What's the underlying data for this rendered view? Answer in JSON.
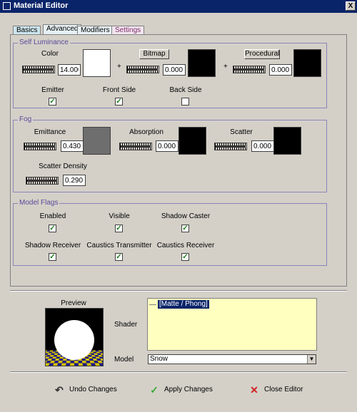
{
  "window": {
    "title": "Material Editor",
    "close_glyph": "X"
  },
  "tabs": [
    {
      "label": "Basics"
    },
    {
      "label": "Advanced"
    },
    {
      "label": "Modifiers"
    },
    {
      "label": "Settings"
    }
  ],
  "self_luminance": {
    "group_label": "Self Luminance",
    "color_label": "Color",
    "color_value": "14.000",
    "bitmap_button": "Bitmap",
    "bitmap_value": "0.000",
    "procedural_button": "Procedural",
    "procedural_value": "0.000",
    "plus_sign": "+",
    "emitter_label": "Emitter",
    "emitter_checked": true,
    "front_side_label": "Front Side",
    "front_side_checked": true,
    "back_side_label": "Back Side",
    "back_side_checked": false,
    "color_swatch": "#ffffff",
    "bitmap_swatch": "#000000",
    "procedural_swatch": "#000000"
  },
  "fog": {
    "group_label": "Fog",
    "emittance_label": "Emittance",
    "emittance_value": "0.430",
    "emittance_swatch": "#6e6e6e",
    "absorption_label": "Absorption",
    "absorption_value": "0.000",
    "absorption_swatch": "#000000",
    "scatter_label": "Scatter",
    "scatter_value": "0.000",
    "scatter_swatch": "#000000",
    "scatter_density_label": "Scatter Density",
    "scatter_density_value": "0.290"
  },
  "model_flags": {
    "group_label": "Model Flags",
    "flags": [
      {
        "label": "Enabled",
        "checked": true
      },
      {
        "label": "Visible",
        "checked": true
      },
      {
        "label": "Shadow Caster",
        "checked": true
      },
      {
        "label": "Shadow Receiver",
        "checked": true
      },
      {
        "label": "Caustics Transmitter",
        "checked": true
      },
      {
        "label": "Caustics Receiver",
        "checked": true
      }
    ]
  },
  "preview": {
    "label": "Preview"
  },
  "shader": {
    "label": "Shader",
    "selected_item": "[Matte / Phong]"
  },
  "model": {
    "label": "Model",
    "selected": "Snow"
  },
  "actions": {
    "undo": "Undo Changes",
    "apply": "Apply Changes",
    "close": "Close Editor"
  },
  "check_glyph": "✓"
}
